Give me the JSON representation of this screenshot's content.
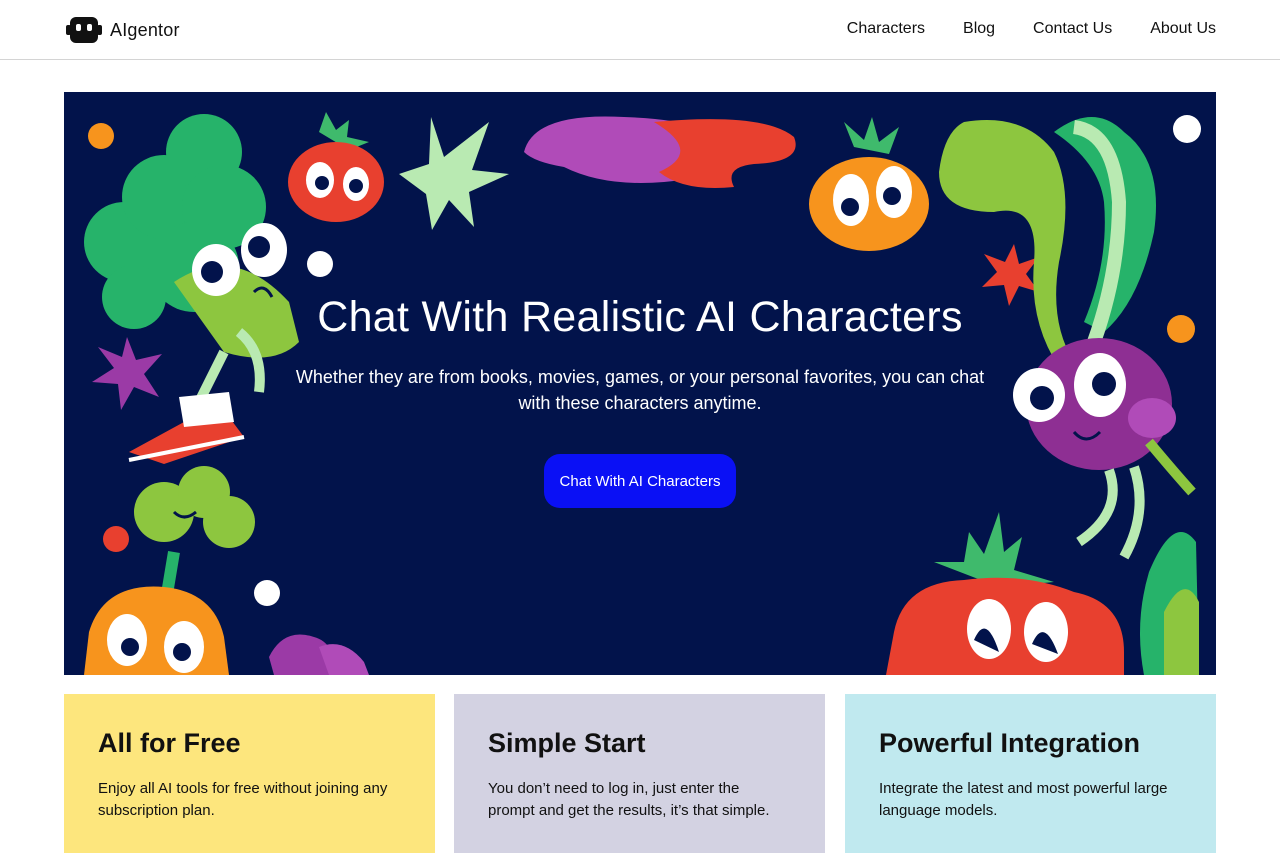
{
  "header": {
    "brand_name": "AIgentor",
    "logo_icon": "robot-face-icon",
    "nav": [
      {
        "label": "Characters"
      },
      {
        "label": "Blog"
      },
      {
        "label": "Contact Us"
      },
      {
        "label": "About Us"
      }
    ]
  },
  "hero": {
    "title": "Chat With Realistic AI Characters",
    "subtitle": "Whether they are from books, movies, games, or your personal favorites, you can chat with these characters anytime.",
    "cta_label": "Chat With AI Characters",
    "background_color": "#02134b",
    "cta_color": "#0a10f5",
    "illustration": "cartoon-vegetable-characters"
  },
  "features": [
    {
      "title": "All for Free",
      "description": "Enjoy all AI tools for free without joining any subscription plan.",
      "color": "#fde67d"
    },
    {
      "title": "Simple Start",
      "description": "You don’t need to log in, just enter the prompt and get the results, it’s that simple.",
      "color": "#d3d2e2"
    },
    {
      "title": "Powerful Integration",
      "description": "Integrate the latest and most powerful large language models.",
      "color": "#c0e9ef"
    }
  ]
}
